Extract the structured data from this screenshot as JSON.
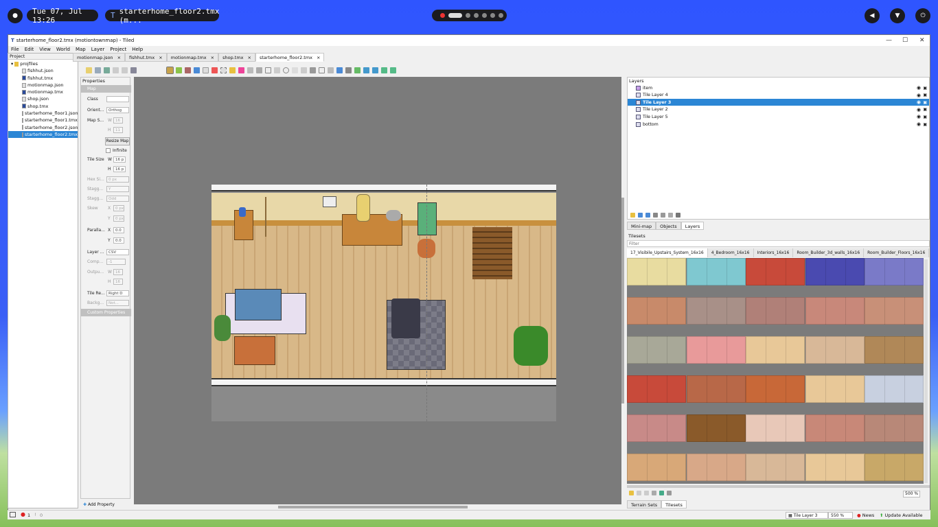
{
  "topbar": {
    "datetime": "Tue 07, Jul 13:26",
    "active_window": "starterhome_floor2.tmx (m..."
  },
  "window": {
    "title": "starterhome_floor2.tmx (motiontownmap) - Tiled",
    "menu": [
      "File",
      "Edit",
      "View",
      "World",
      "Map",
      "Layer",
      "Project",
      "Help"
    ]
  },
  "project": {
    "title": "Project",
    "root": "projfiles",
    "files": [
      "fishhut.json",
      "fishhut.tmx",
      "motionmap.json",
      "motionmap.tmx",
      "shop.json",
      "shop.tmx",
      "starterhome_floor1.json",
      "starterhome_floor1.tmx",
      "starterhome_floor2.json",
      "starterhome_floor2.tmx"
    ],
    "selected": "starterhome_floor2.tmx"
  },
  "tabs": [
    "motionmap.json",
    "fishhut.tmx",
    "motionmap.tmx",
    "shop.tmx",
    "starterhome_floor2.tmx"
  ],
  "properties": {
    "title": "Properties",
    "section_map": "Map",
    "class_label": "Class",
    "orientation_label": "Orient...",
    "orientation_value": "Orthog",
    "mapsize_label": "Map S...",
    "w_label": "W",
    "h_label": "H",
    "map_w": "16",
    "map_h": "11",
    "resize_button": "Resize Map",
    "infinite_label": "Infinite",
    "tilesize_label": "Tile Size",
    "tile_w": "16 p",
    "tile_h": "16 p",
    "hexside_label": "Hex Si...",
    "hexside_value": "0 px",
    "stagger_axis_label": "Stagg...",
    "stagger_axis_value": "Y",
    "stagger_index_label": "Stagg...",
    "stagger_index_value": "Odd",
    "skew_label": "Skew",
    "x_label": "X",
    "y_label": "Y",
    "skew_x": "0 px",
    "skew_y": "0 px",
    "parallax_label": "Paralla...",
    "parallax_x": "0.0",
    "parallax_y": "0.0",
    "layer_format_label": "Layer ...",
    "layer_format_value": "CSV",
    "compression_label": "Comp...",
    "compression_value": "-1",
    "output_label": "Outpu...",
    "output_w": "16",
    "output_h": "16",
    "render_order_label": "Tile Re...",
    "render_order_value": "Right D",
    "background_label": "Backg...",
    "background_value": "Not...",
    "custom_section": "Custom Properties",
    "add_property": "Add Property"
  },
  "layers": {
    "title": "Layers",
    "items": [
      "item",
      "Tile Layer 4",
      "Tile Layer 3",
      "Tile Layer 2",
      "Tile Layer 5",
      "bottom"
    ],
    "selected": "Tile Layer 3"
  },
  "bottom_tabs": [
    "Mini-map",
    "Objects",
    "Layers"
  ],
  "tilesets": {
    "title": "Tilesets",
    "filter_placeholder": "Filter",
    "tabs": [
      "17_Visibile_Upstairs_System_16x16",
      "4_Bedroom_16x16",
      "Interiors_16x16",
      "Room_Builder_3d_walls_16x16",
      "Room_Builder_Floors_16x16"
    ],
    "zoom": "500 %",
    "bottom_tabs": [
      "Terrain Sets",
      "Tilesets"
    ]
  },
  "status": {
    "errors": "1",
    "warnings": "0",
    "layer": "Tile Layer 3",
    "zoom": "550 %",
    "news": "News",
    "update": "Update Available"
  },
  "colors": {
    "selection": "#2b86d5",
    "desktop": "#2f55ff"
  }
}
